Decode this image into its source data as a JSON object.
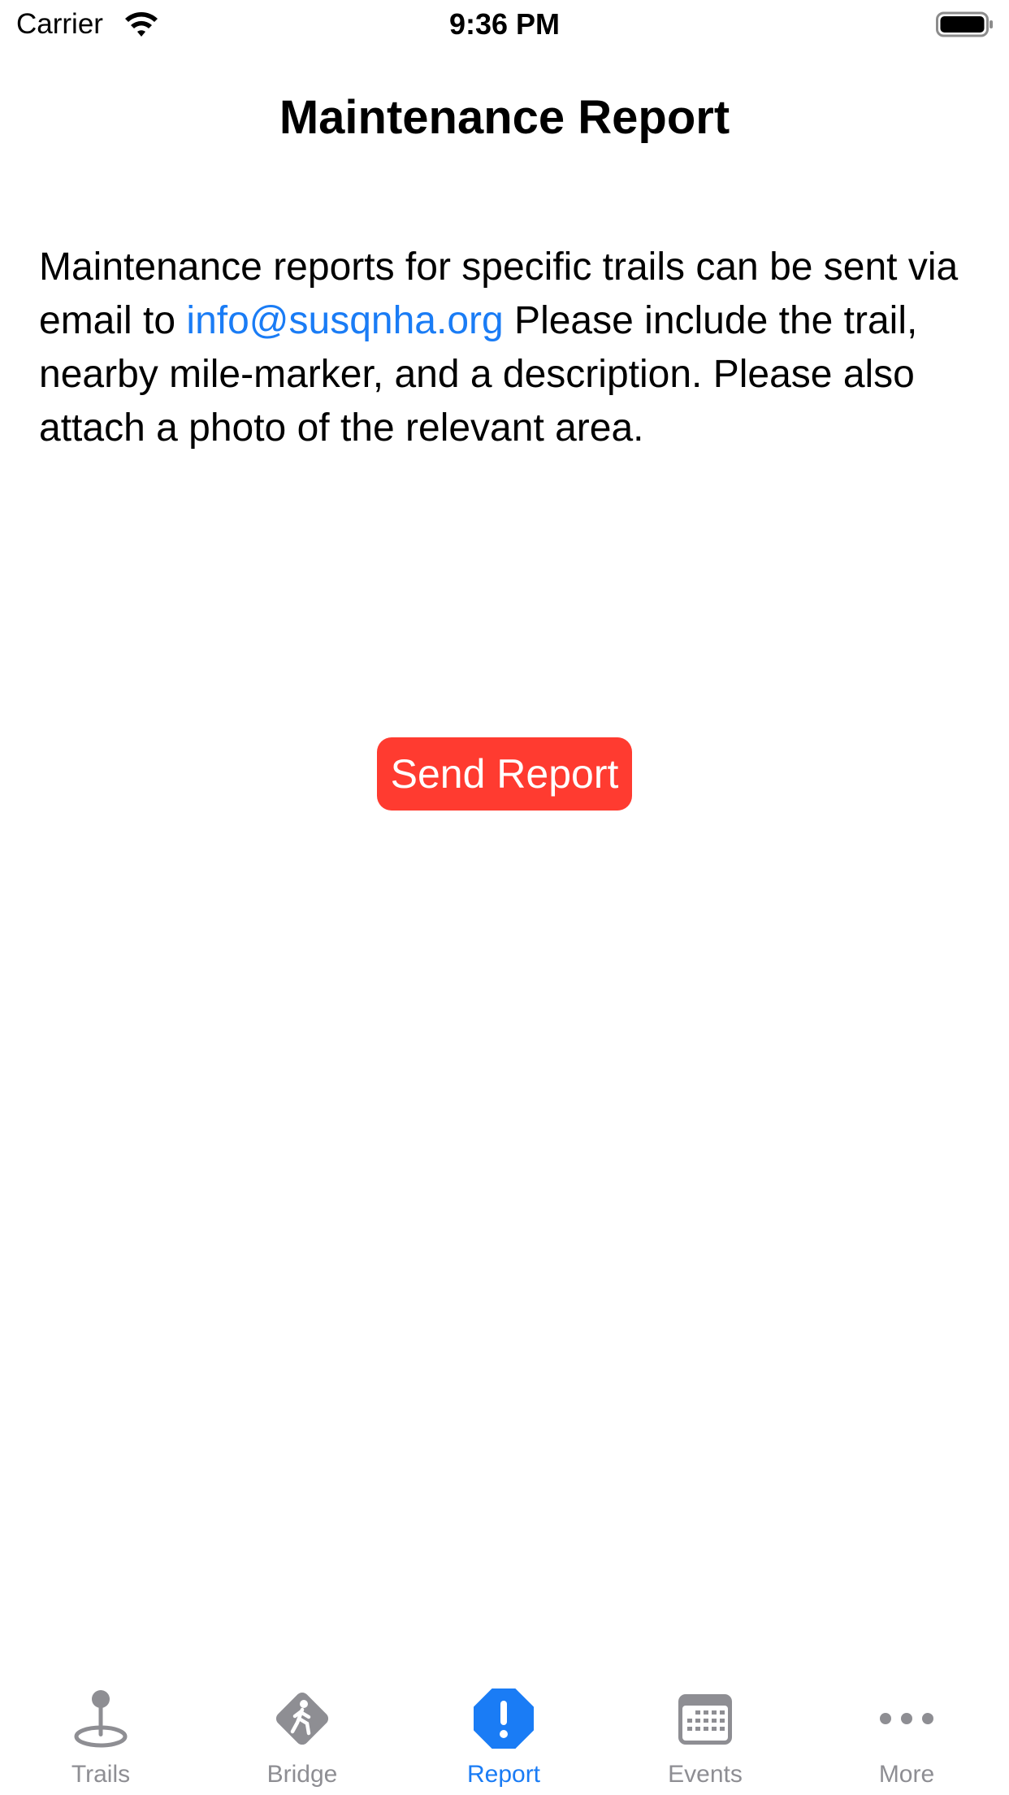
{
  "status_bar": {
    "carrier": "Carrier",
    "time": "9:36 PM"
  },
  "page": {
    "title": "Maintenance Report",
    "body_before_link": "Maintenance reports for specific trails can be sent via email to ",
    "email": "info@susqnha.org",
    "body_after_link": "  Please include the trail, nearby mile-marker, and a description. Please also attach a photo of the relevant area.",
    "send_button_label": "Send Report"
  },
  "tab_bar": {
    "tabs": [
      {
        "label": "Trails",
        "icon": "map-pin-icon",
        "active": false
      },
      {
        "label": "Bridge",
        "icon": "pedestrian-sign-icon",
        "active": false
      },
      {
        "label": "Report",
        "icon": "exclamation-octagon-icon",
        "active": true
      },
      {
        "label": "Events",
        "icon": "calendar-icon",
        "active": false
      },
      {
        "label": "More",
        "icon": "ellipsis-icon",
        "active": false
      }
    ]
  },
  "colors": {
    "accent": "#1a7cf5",
    "button": "#ff3b30",
    "inactive_tab": "#8e8e93"
  }
}
